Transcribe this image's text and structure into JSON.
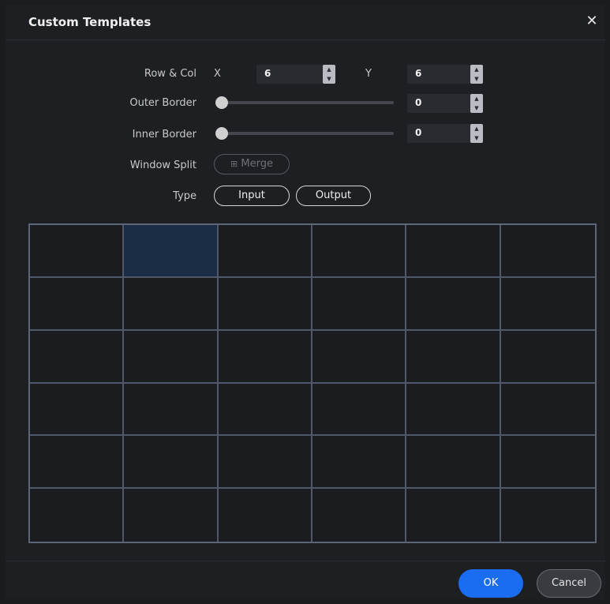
{
  "dialog": {
    "title": "Custom Templates",
    "close_icon": "close-icon"
  },
  "row_col": {
    "label": "Row & Col",
    "x_label": "X",
    "x_value": "6",
    "y_label": "Y",
    "y_value": "6"
  },
  "outer_border": {
    "label": "Outer Border",
    "value": "0",
    "slider_level": 0
  },
  "inner_border": {
    "label": "Inner Border",
    "value": "0",
    "slider_level": 0
  },
  "window_split": {
    "label": "Window Split",
    "merge_label": "Merge",
    "merge_icon": "merge-grid-icon",
    "merge_enabled": false
  },
  "type": {
    "label": "Type",
    "input_label": "Input",
    "output_label": "Output"
  },
  "grid": {
    "rows": 6,
    "cols": 6,
    "selected_cell": {
      "row": 1,
      "col": 2
    }
  },
  "footer": {
    "ok_label": "OK",
    "cancel_label": "Cancel"
  },
  "colors": {
    "accent": "#1a6df0",
    "selected_cell": "#1a2d44",
    "grid_line": "#4f5868"
  }
}
